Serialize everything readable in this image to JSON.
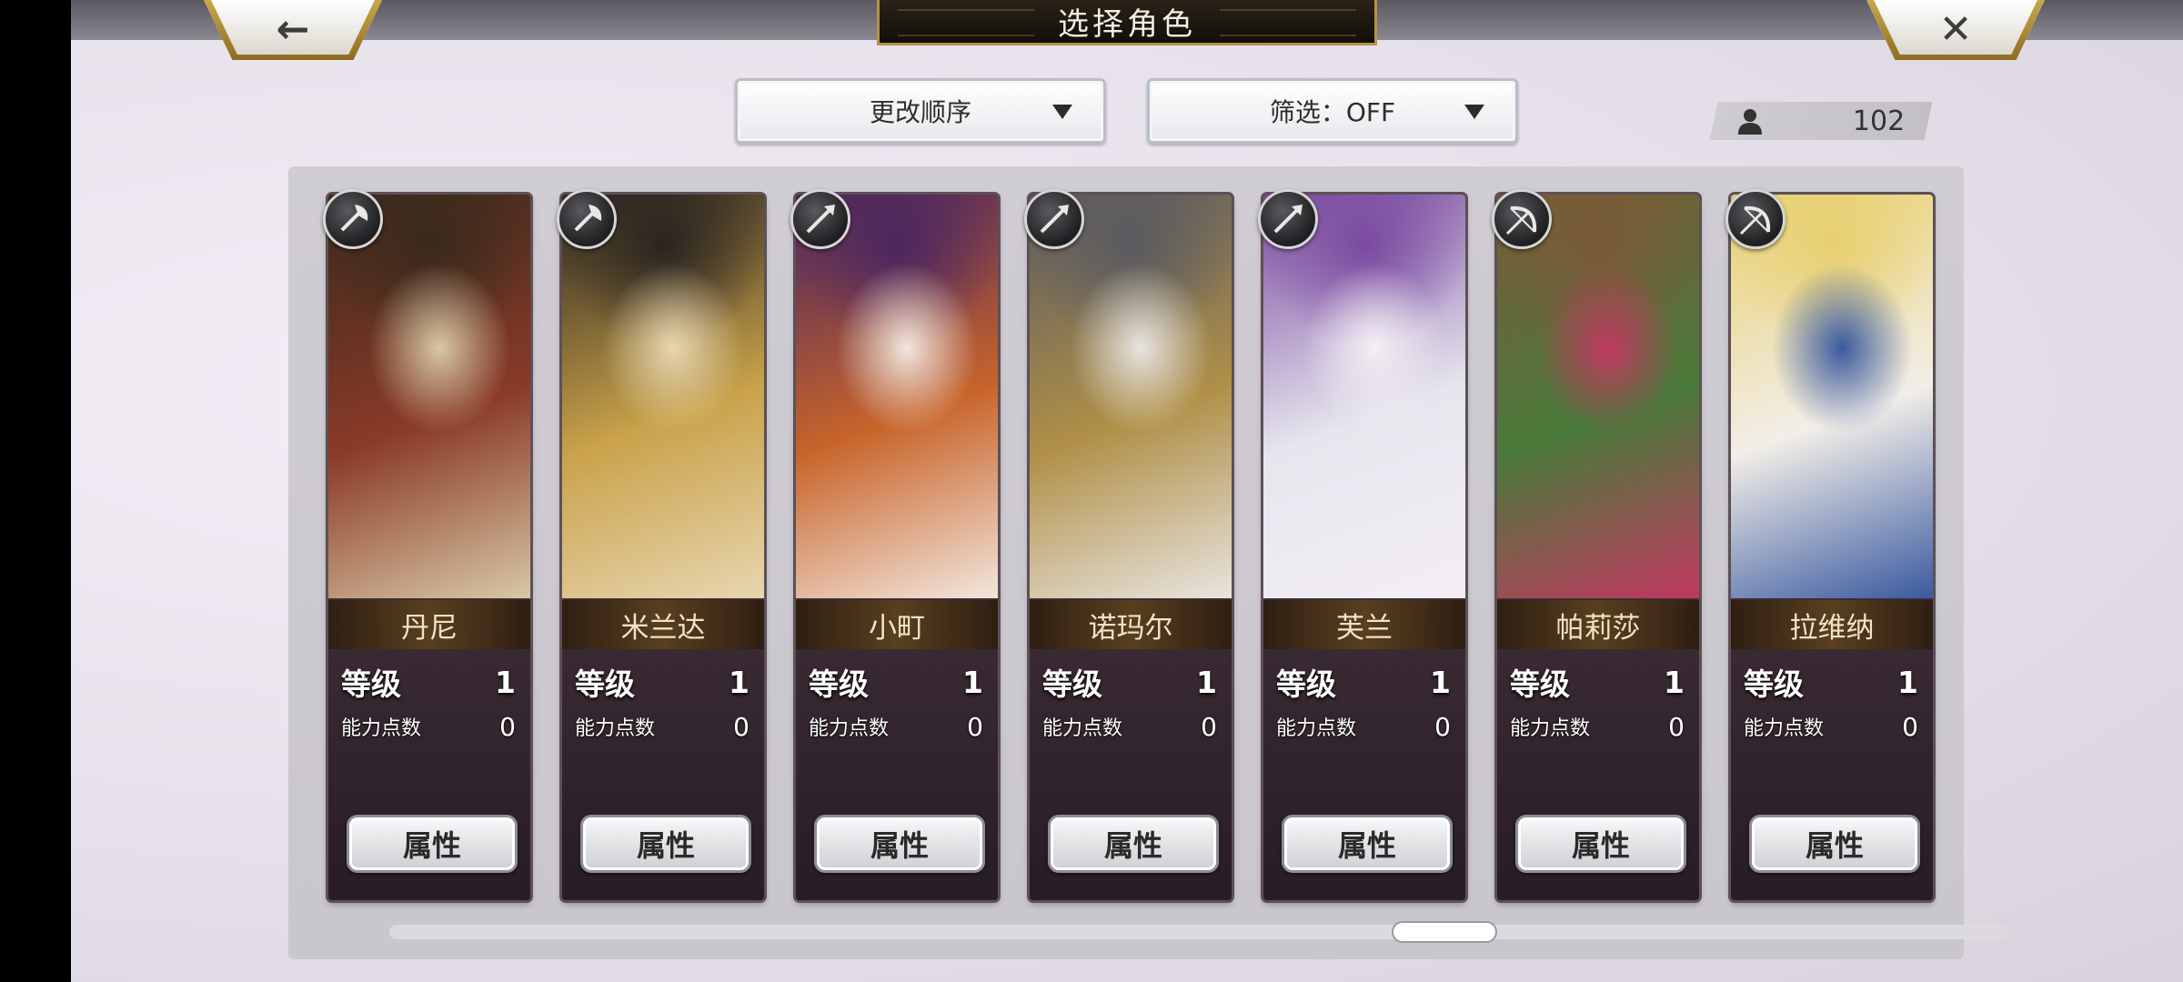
{
  "header": {
    "title": "选择角色",
    "back_glyph": "←",
    "close_glyph": "✕"
  },
  "controls": {
    "sort_label": "更改顺序",
    "filter_label": "筛选：OFF",
    "character_count": "102"
  },
  "labels": {
    "level": "等级",
    "ability_points": "能力点数",
    "attributes_button": "属性"
  },
  "characters": [
    {
      "name": "丹尼",
      "level": "1",
      "points": "0",
      "class_icon": "axe-icon",
      "portrait_colors": [
        "#3a2a1c",
        "#8a3a28",
        "#d8c8a4"
      ]
    },
    {
      "name": "米兰达",
      "level": "1",
      "points": "0",
      "class_icon": "axe-icon",
      "portrait_colors": [
        "#2a2420",
        "#c9a24a",
        "#e8d6b0"
      ]
    },
    {
      "name": "小町",
      "level": "1",
      "points": "0",
      "class_icon": "spear-icon",
      "portrait_colors": [
        "#4a2660",
        "#c8642a",
        "#f2e6dc"
      ]
    },
    {
      "name": "诺玛尔",
      "level": "1",
      "points": "0",
      "class_icon": "spear-icon",
      "portrait_colors": [
        "#5a5a60",
        "#b09048",
        "#e8e4de"
      ]
    },
    {
      "name": "芙兰",
      "level": "1",
      "points": "0",
      "class_icon": "spear-icon",
      "portrait_colors": [
        "#7a4aa0",
        "#e6e6ee",
        "#f4eef4"
      ]
    },
    {
      "name": "帕莉莎",
      "level": "1",
      "points": "0",
      "class_icon": "bow-icon",
      "portrait_colors": [
        "#7a5a38",
        "#4a7a3a",
        "#c03860"
      ]
    },
    {
      "name": "拉维纳",
      "level": "1",
      "points": "0",
      "class_icon": "bow-icon",
      "portrait_colors": [
        "#e8d070",
        "#f2eee8",
        "#3a5aa0"
      ]
    }
  ]
}
